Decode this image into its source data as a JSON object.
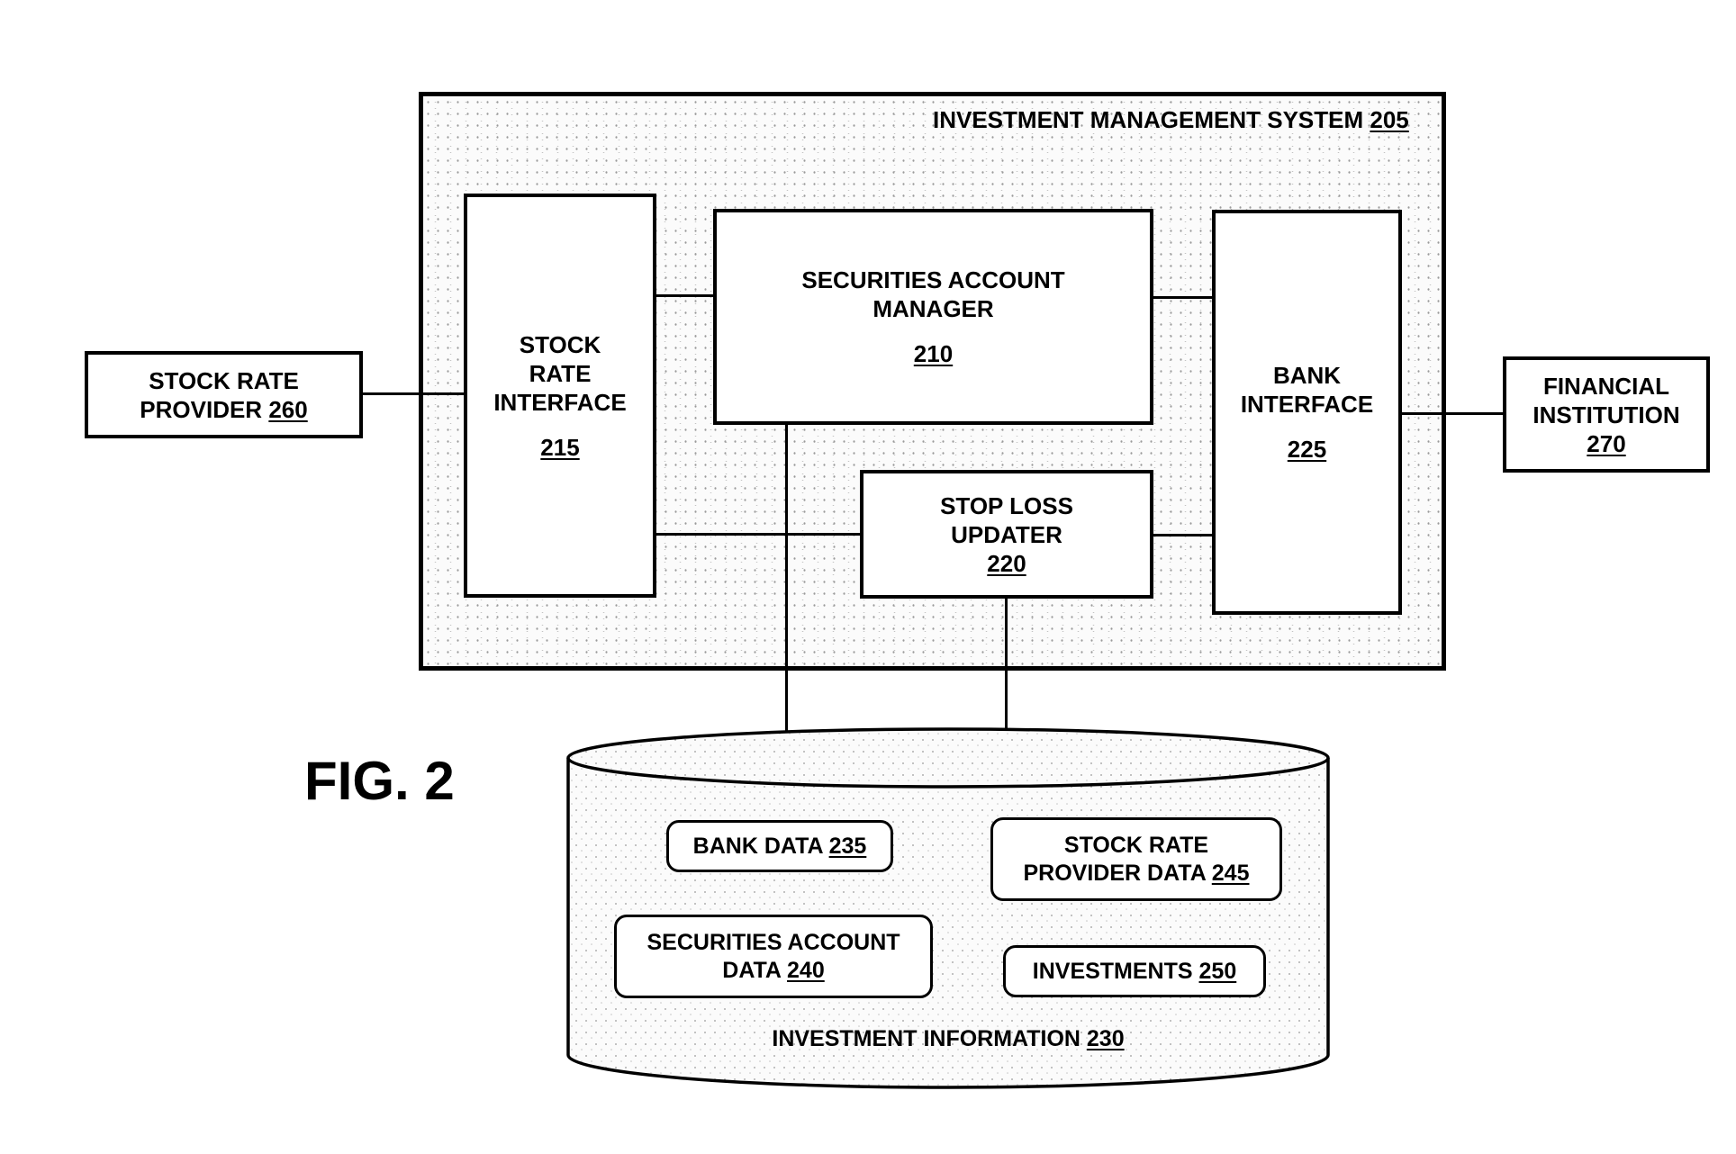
{
  "figure": {
    "label": "FIG. 2"
  },
  "system": {
    "name": "INVESTMENT MANAGEMENT SYSTEM",
    "ref": "205"
  },
  "components": {
    "securities_account_manager": {
      "line1": "SECURITIES ACCOUNT",
      "line2": "MANAGER",
      "ref": "210"
    },
    "stock_rate_interface": {
      "line1": "STOCK",
      "line2": "RATE",
      "line3": "INTERFACE",
      "ref": "215"
    },
    "stop_loss_updater": {
      "line1": "STOP LOSS",
      "line2": "UPDATER",
      "ref": "220"
    },
    "bank_interface": {
      "line1": "BANK",
      "line2": "INTERFACE",
      "ref": "225"
    }
  },
  "external": {
    "stock_rate_provider": {
      "line1": "STOCK RATE",
      "line2": "PROVIDER",
      "ref": "260"
    },
    "financial_institution": {
      "line1": "FINANCIAL",
      "line2": "INSTITUTION",
      "ref": "270"
    }
  },
  "database": {
    "name": "INVESTMENT INFORMATION",
    "ref": "230",
    "items": {
      "bank_data": {
        "line1": "BANK DATA",
        "ref": "235"
      },
      "securities_account_data": {
        "line1": "SECURITIES ACCOUNT",
        "line2": "DATA",
        "ref": "240"
      },
      "stock_rate_provider_data": {
        "line1": "STOCK RATE",
        "line2": "PROVIDER DATA",
        "ref": "245"
      },
      "investments": {
        "line1": "INVESTMENTS",
        "ref": "250"
      }
    }
  },
  "connections": [
    {
      "from": "stock_rate_provider",
      "to": "stock_rate_interface"
    },
    {
      "from": "stock_rate_interface",
      "to": "securities_account_manager"
    },
    {
      "from": "stock_rate_interface",
      "to": "stop_loss_updater"
    },
    {
      "from": "securities_account_manager",
      "to": "bank_interface"
    },
    {
      "from": "stop_loss_updater",
      "to": "bank_interface"
    },
    {
      "from": "bank_interface",
      "to": "financial_institution"
    },
    {
      "from": "securities_account_manager",
      "to": "investment_information"
    },
    {
      "from": "stop_loss_updater",
      "to": "investment_information"
    }
  ]
}
